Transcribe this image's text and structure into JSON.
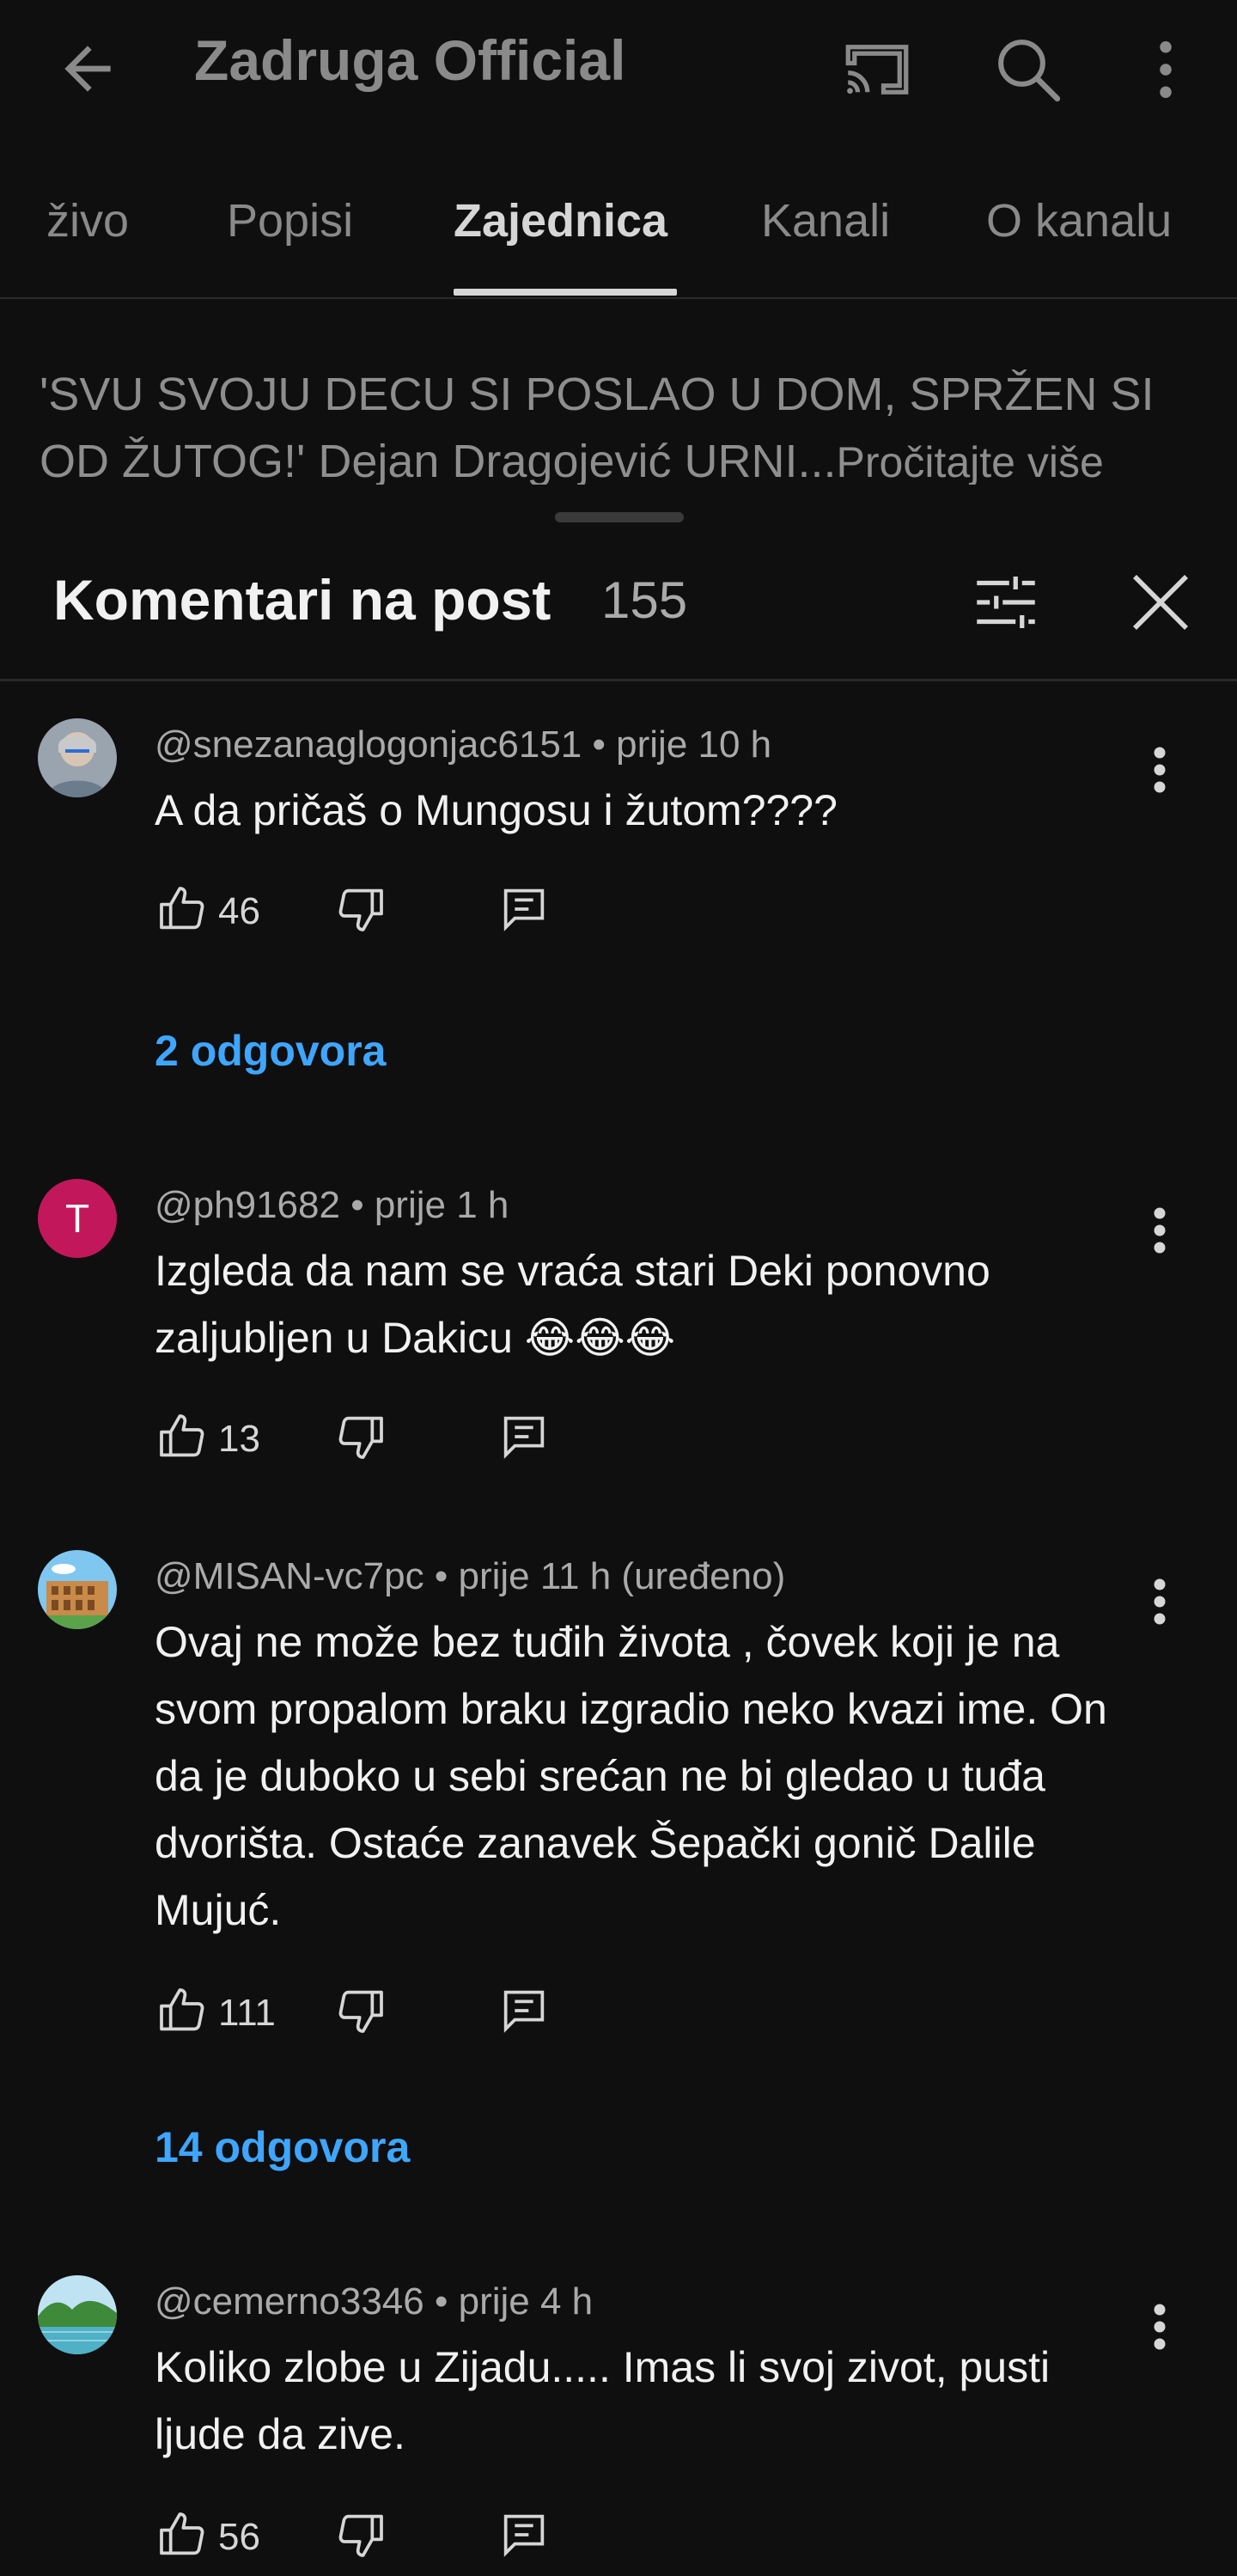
{
  "header": {
    "title": "Zadruga Official",
    "icons": [
      "back-arrow-icon",
      "cast-icon",
      "search-icon",
      "more-vert-icon"
    ]
  },
  "tabs": [
    {
      "label": "živo"
    },
    {
      "label": "Popisi"
    },
    {
      "label": "Zajednica",
      "active": true
    },
    {
      "label": "Kanali"
    },
    {
      "label": "O kanalu"
    }
  ],
  "post": {
    "text": "'SVU SVOJU DECU SI POSLAO U DOM, SPRŽEN SI OD ŽUTOG!' Dejan Dragojević URNI...",
    "read_more": "Pročitajte više"
  },
  "comments_sheet": {
    "title": "Komentari na post",
    "count": "155",
    "icons": [
      "filter-icon",
      "close-icon"
    ]
  },
  "comments": [
    {
      "author": "@snezanaglogonjac6151",
      "time": "prije 10 h",
      "text": "A da pričaš o Mungosu i žutom????",
      "likes": "46",
      "replies": "2 odgovora",
      "avatar": "photo-avatar"
    },
    {
      "author": "@ph91682",
      "time": "prije 1 h",
      "text": "Izgleda da nam se vraća stari Deki ponovno zaljubljen u Dakicu 😂😂😂",
      "likes": "13",
      "avatar_letter": "T",
      "avatar_color": "#c2185b"
    },
    {
      "author": "@MISAN-vc7pc",
      "time": "prije 11 h (uređeno)",
      "text": "Ovaj ne može bez tuđih života , čovek koji je na svom propalom braku izgradio neko kvazi ime. On da je duboko u sebi srećan ne bi gledao u tuđa dvorišta. Ostaće zanavek Šepački gonič Dalile Mujuć.",
      "likes": "111",
      "replies": "14 odgovora",
      "avatar": "colosseum-avatar"
    },
    {
      "author": "@cemerno3346",
      "time": "prije 4 h",
      "text": "Koliko zlobe u Zijadu..... Imas li svoj zivot, pusti ljude da zive.",
      "likes": "56",
      "avatar": "landscape-avatar"
    }
  ],
  "colors": {
    "background": "#0f0f0f",
    "link_blue": "#3ea6ff",
    "muted_text": "#aaaaaa"
  }
}
